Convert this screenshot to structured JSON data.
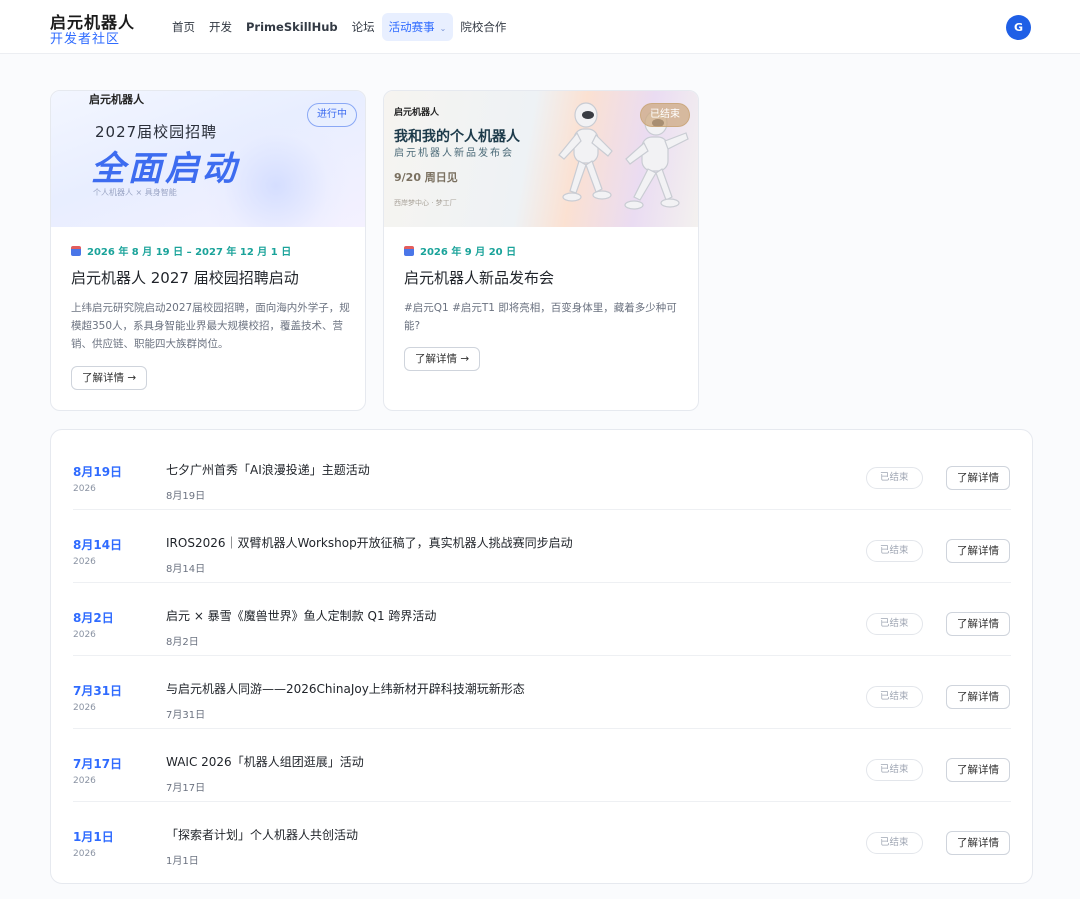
{
  "header": {
    "logo_title": "启元机器人",
    "logo_sub": "开发者社区",
    "nav": [
      {
        "label": "首页"
      },
      {
        "label": "开发"
      },
      {
        "label": "PrimeSkillHub"
      },
      {
        "label": "论坛"
      },
      {
        "label": "活动赛事",
        "active": true
      },
      {
        "label": "院校合作"
      }
    ],
    "avatar_letter": "G",
    "accent": "#2f6bff"
  },
  "cards": [
    {
      "banner": {
        "brand": "启元机器人",
        "line1": "2027届校园招聘",
        "big": "全面启动",
        "small": "个人机器人 × 具身智能"
      },
      "status": "进行中",
      "date": "2026 年 8 月 19 日 – 2027 年 12 月 1 日",
      "title": "启元机器人 2027 届校园招聘启动",
      "desc": "上纬启元研究院启动2027届校园招聘，面向海内外学子，规模超350人，系具身智能业界最大规模校招，覆盖技术、营销、供应链、职能四大族群岗位。",
      "button": "了解详情 →"
    },
    {
      "banner": {
        "brand": "启元机器人",
        "title": "我和我的个人机器人",
        "sub": "启元机器人新品发布会",
        "date": "9/20 周日见",
        "foot": "西岸梦中心 · 梦工厂"
      },
      "status": "已结束",
      "date": "2026 年 9 月 20 日",
      "title": "启元机器人新品发布会",
      "desc": "#启元Q1 #启元T1 即将亮相，百变身体里，藏着多少种可能?",
      "button": "了解详情 →"
    }
  ],
  "events": [
    {
      "date": "8月19日",
      "year": "2026",
      "title": "七夕广州首秀「AI浪漫投递」主题活动",
      "sub": "8月19日",
      "status": "已结束",
      "button": "了解详情"
    },
    {
      "date": "8月14日",
      "year": "2026",
      "title": "IROS2026｜双臂机器人Workshop开放征稿了，真实机器人挑战赛同步启动",
      "sub": "8月14日",
      "status": "已结束",
      "button": "了解详情"
    },
    {
      "date": "8月2日",
      "year": "2026",
      "title": "启元 × 暴雪《魔兽世界》鱼人定制款 Q1 跨界活动",
      "sub": "8月2日",
      "status": "已结束",
      "button": "了解详情"
    },
    {
      "date": "7月31日",
      "year": "2026",
      "title": "与启元机器人同游——2026ChinaJoy上纬新材开辟科技潮玩新形态",
      "sub": "7月31日",
      "status": "已结束",
      "button": "了解详情"
    },
    {
      "date": "7月17日",
      "year": "2026",
      "title": "WAIC 2026「机器人组团逛展」活动",
      "sub": "7月17日",
      "status": "已结束",
      "button": "了解详情"
    },
    {
      "date": "1月1日",
      "year": "2026",
      "title": "「探索者计划」个人机器人共创活动",
      "sub": "1月1日",
      "status": "已结束",
      "button": "了解详情"
    }
  ]
}
